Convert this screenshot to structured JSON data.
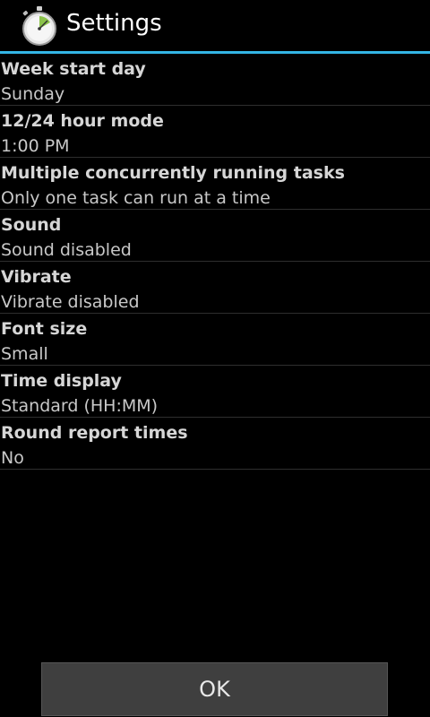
{
  "action_bar": {
    "title": "Settings",
    "icon": "stopwatch-icon",
    "divider_color": "#33b5e5"
  },
  "settings": [
    {
      "title": "Week start day",
      "summary": "Sunday"
    },
    {
      "title": "12/24 hour mode",
      "summary": "1:00 PM"
    },
    {
      "title": "Multiple concurrently running tasks",
      "summary": "Only one task can run at a time"
    },
    {
      "title": "Sound",
      "summary": "Sound disabled"
    },
    {
      "title": "Vibrate",
      "summary": "Vibrate disabled"
    },
    {
      "title": "Font size",
      "summary": "Small"
    },
    {
      "title": "Time display",
      "summary": "Standard (HH:MM)"
    },
    {
      "title": "Round report times",
      "summary": "No"
    }
  ],
  "ok_button": {
    "label": "OK"
  }
}
